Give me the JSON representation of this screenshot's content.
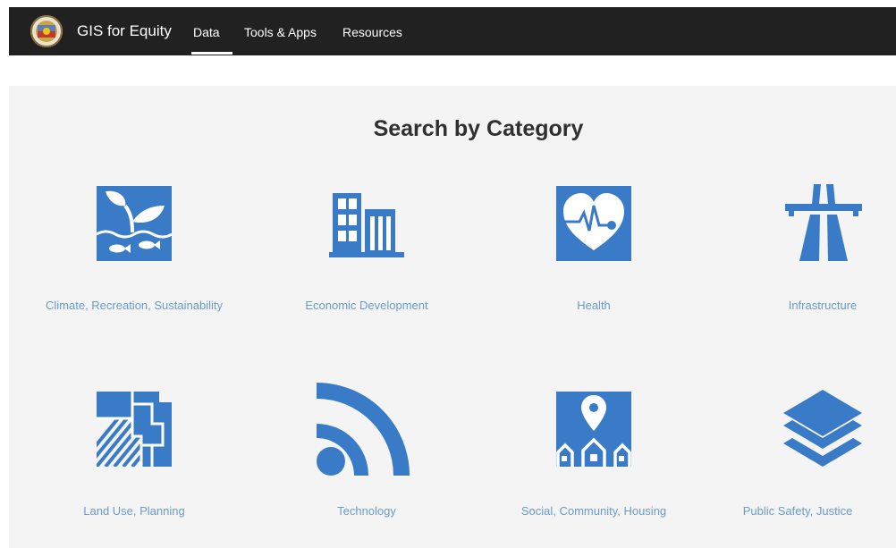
{
  "header": {
    "site_title": "GIS for Equity",
    "nav": [
      "Data",
      "Tools & Apps",
      "Resources"
    ],
    "active_nav": "Data"
  },
  "main": {
    "title": "Search by Category",
    "categories": [
      {
        "label": "Climate, Recreation, Sustainability",
        "icon": "plant-water-fish-icon"
      },
      {
        "label": "Economic Development",
        "icon": "buildings-icon"
      },
      {
        "label": "Health",
        "icon": "heart-pulse-icon"
      },
      {
        "label": "Infrastructure",
        "icon": "highway-icon"
      },
      {
        "label": "Land Use, Planning",
        "icon": "parcel-map-icon"
      },
      {
        "label": "Technology",
        "icon": "rss-feed-icon"
      },
      {
        "label": "Social, Community, Housing",
        "icon": "houses-location-pin-icon"
      },
      {
        "label": "Public Safety, Justice",
        "icon": "layers-icon"
      }
    ]
  },
  "colors": {
    "header_bg": "#212121",
    "panel_bg": "#f4f4f4",
    "icon_blue": "#3a7bc8",
    "label_blue": "#6b9cc9",
    "title_text": "#303030"
  }
}
